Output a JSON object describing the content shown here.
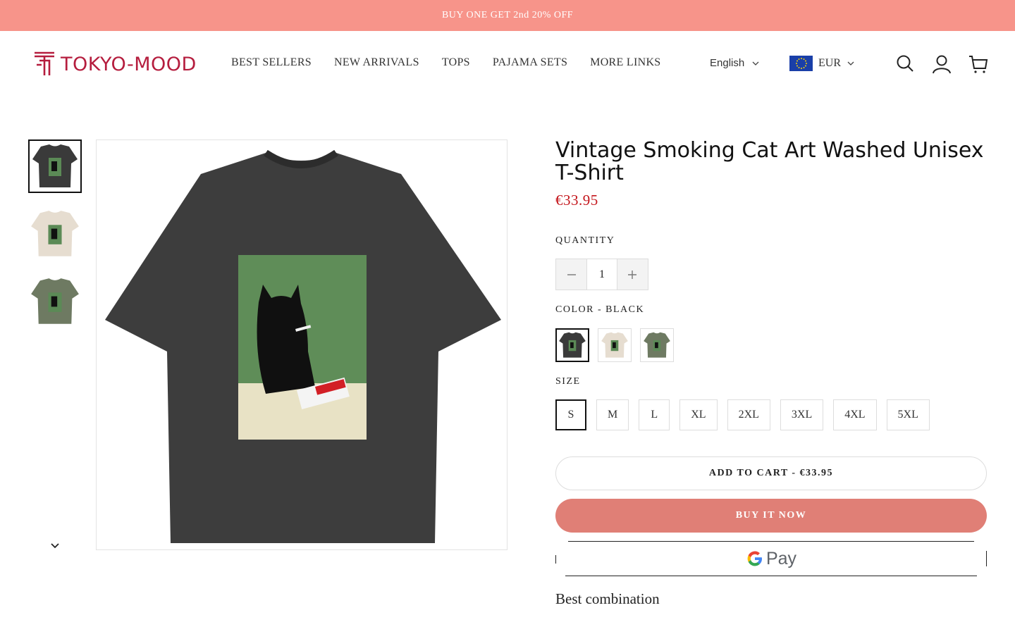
{
  "announcement": "BUY ONE GET 2nd 20% OFF",
  "brand": {
    "name": "TOKYO-MOOD",
    "color": "#b51d3e"
  },
  "nav": [
    "BEST SELLERS",
    "NEW ARRIVALS",
    "TOPS",
    "PAJAMA SETS",
    "MORE LINKS"
  ],
  "language": "English",
  "currency": "EUR",
  "header_icons": [
    "search-icon",
    "account-icon",
    "cart-icon"
  ],
  "product": {
    "title": "Vintage Smoking Cat Art Washed Unisex T-Shirt",
    "price": "€33.95",
    "quantity_label": "QUANTITY",
    "quantity": "1",
    "color_label": "COLOR - BLACK",
    "colors": [
      "Black",
      "Beige",
      "Green"
    ],
    "size_label": "SIZE",
    "sizes": [
      "S",
      "M",
      "L",
      "XL",
      "2XL",
      "3XL",
      "4XL",
      "5XL"
    ],
    "selected_size": "S",
    "add_to_cart": "ADD TO CART - €33.95",
    "buy_now": "BUY IT NOW",
    "gpay": "Pay",
    "best_combination": "Best combination"
  },
  "colors": {
    "announcement_bg": "#f7948a",
    "price": "#c4161c",
    "buy_now_bg": "#e07f76"
  }
}
